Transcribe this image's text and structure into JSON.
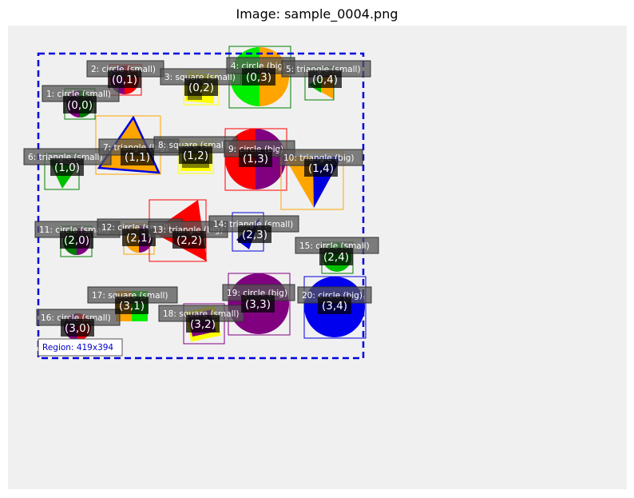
{
  "title": "Image: sample_0004.png",
  "region_label": "Region: 419x394",
  "colors": {
    "panel": "#f0f0f0",
    "region_border": "#0000dd",
    "label_box": "#555555",
    "cell_box": "#000000"
  },
  "objects": [
    {
      "label": "1: circle (small)",
      "cell": "(0,0)"
    },
    {
      "label": "2: circle (small)",
      "cell": "(0,1)"
    },
    {
      "label": "3: square (small)",
      "cell": "(0,2)"
    },
    {
      "label": "4: circle (big)",
      "cell": "(0,3)"
    },
    {
      "label": "5: triangle (small)",
      "cell": "(0,4)"
    },
    {
      "label": "6: triangle (small)",
      "cell": "(1,0)"
    },
    {
      "label": "7: triangle (big)",
      "cell": "(1,1)"
    },
    {
      "label": "8: square (small)",
      "cell": "(1,2)"
    },
    {
      "label": "9: circle (big)",
      "cell": "(1,3)"
    },
    {
      "label": "10: triangle (big)",
      "cell": "(1,4)"
    },
    {
      "label": "11: circle (small)",
      "cell": "(2,0)"
    },
    {
      "label": "12: circle (small)",
      "cell": "(2,1)"
    },
    {
      "label": "13: triangle (big)",
      "cell": "(2,2)"
    },
    {
      "label": "14: triangle (small)",
      "cell": "(2,3)"
    },
    {
      "label": "15: circle (small)",
      "cell": "(2,4)"
    },
    {
      "label": "16: circle (small)",
      "cell": "(3,0)"
    },
    {
      "label": "17: square (small)",
      "cell": "(3,1)"
    },
    {
      "label": "18: square (small)",
      "cell": "(3,2)"
    },
    {
      "label": "19: circle (big)",
      "cell": "(3,3)"
    },
    {
      "label": "20: circle (big)",
      "cell": "(3,4)"
    }
  ]
}
